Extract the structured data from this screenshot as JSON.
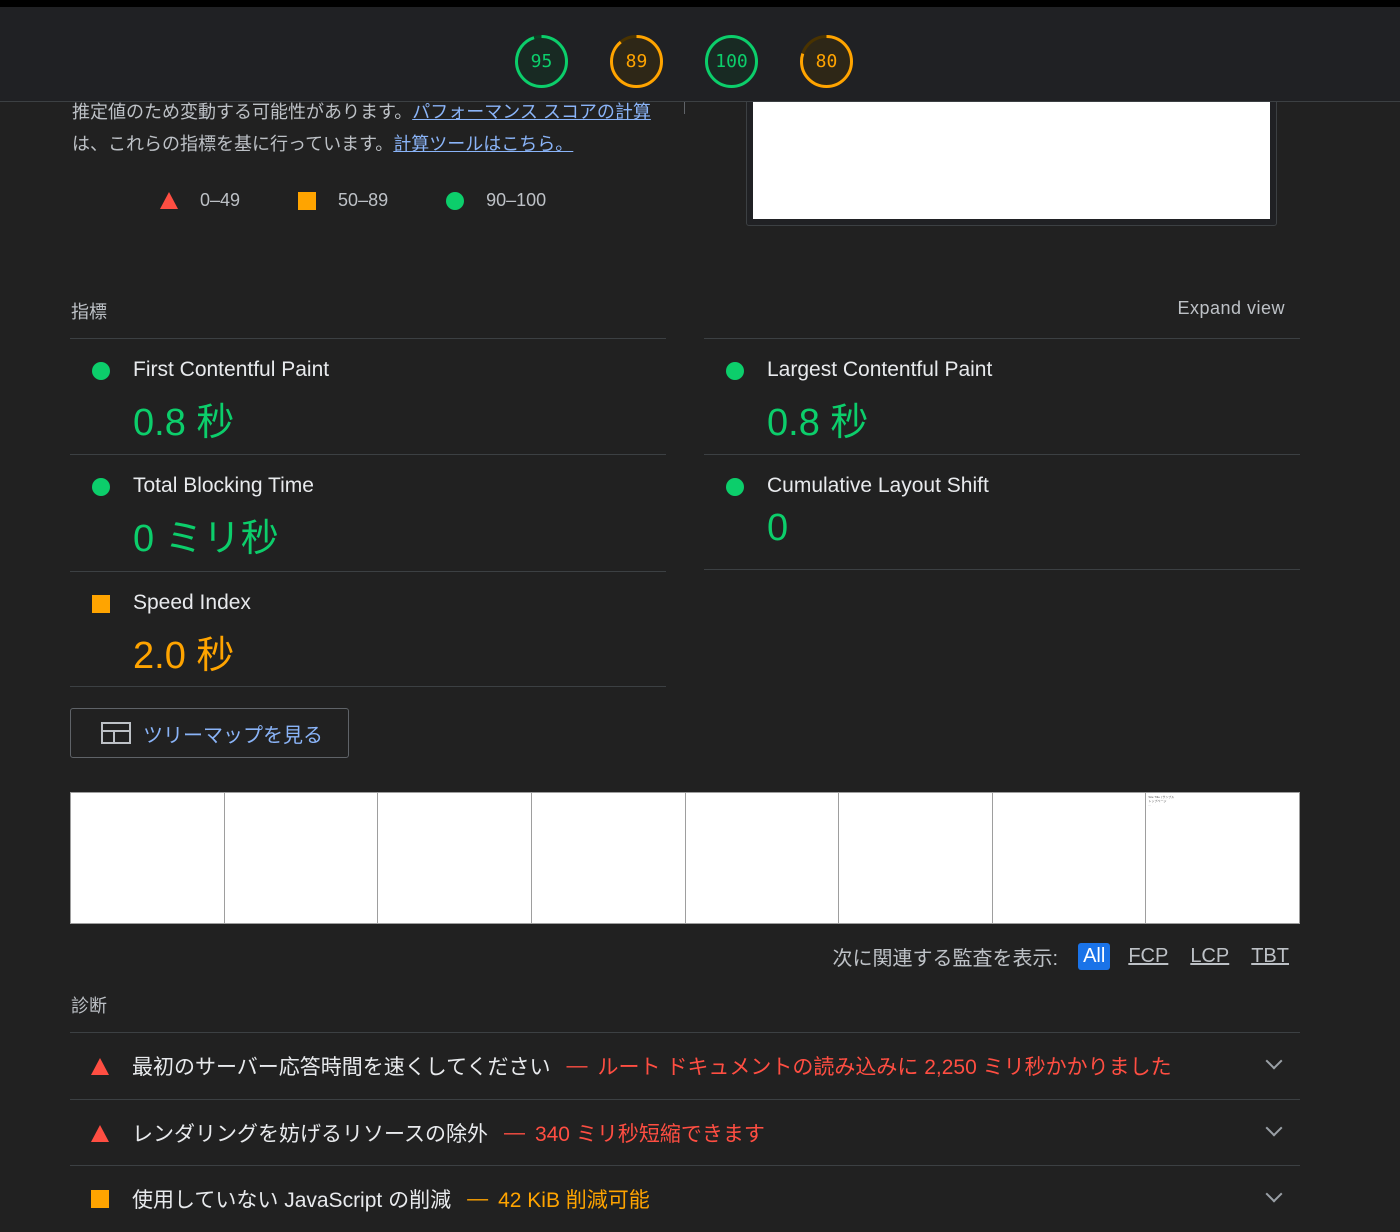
{
  "gauges": [
    {
      "label": "95",
      "value": 95,
      "color": "#0cce6b",
      "track": "#0b3d22"
    },
    {
      "label": "89",
      "value": 89,
      "color": "#ffa400",
      "track": "#4a3300"
    },
    {
      "label": "100",
      "value": 100,
      "color": "#0cce6b",
      "track": "#0b3d22"
    },
    {
      "label": "80",
      "value": 80,
      "color": "#ffa400",
      "track": "#4a3300"
    }
  ],
  "intro": {
    "text1": "推定値のため変動する可能性があります。",
    "link1": "パフォーマンス スコアの計算",
    "text2": "は、これらの指標を基に行っています。",
    "link2": "計算ツールはこちら。"
  },
  "legend": [
    {
      "shape": "triangle",
      "label": "0–49"
    },
    {
      "shape": "square",
      "label": "50–89"
    },
    {
      "shape": "circle",
      "label": "90–100"
    }
  ],
  "metrics_section": {
    "title": "指標",
    "expand": "Expand view"
  },
  "metrics": [
    {
      "name": "First Contentful Paint",
      "value": "0.8 秒",
      "rating": "green"
    },
    {
      "name": "Largest Contentful Paint",
      "value": "0.8 秒",
      "rating": "green"
    },
    {
      "name": "Total Blocking Time",
      "value": "0 ミリ秒",
      "rating": "green"
    },
    {
      "name": "Cumulative Layout Shift",
      "value": "0",
      "rating": "green"
    },
    {
      "name": "Speed Index",
      "value": "2.0 秒",
      "rating": "orange"
    }
  ],
  "treemap_button": "ツリーマップを見る",
  "filmstrip_last_text": "Site Title | サンプル\nトップページ\n...",
  "filter": {
    "label": "次に関連する監査を表示:",
    "chips": [
      "All",
      "FCP",
      "LCP",
      "TBT"
    ]
  },
  "diagnostics": {
    "title": "診断",
    "audits": [
      {
        "title": "最初のサーバー応答時間を速くしてください",
        "sep": "—",
        "detail": "ルート ドキュメントの読み込みに 2,250 ミリ秒かかりました",
        "rating": "red"
      },
      {
        "title": "レンダリングを妨げるリソースの除外",
        "sep": "—",
        "detail": "340 ミリ秒短縮できます",
        "rating": "red"
      },
      {
        "title": "使用していない JavaScript の削減",
        "sep": "—",
        "detail": "42 KiB 削減可能",
        "rating": "orange"
      }
    ]
  }
}
